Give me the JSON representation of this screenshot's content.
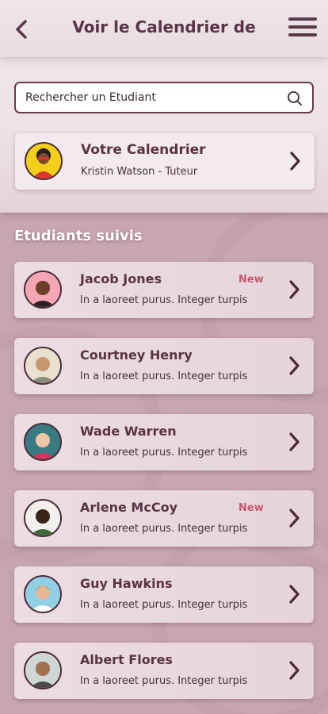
{
  "header": {
    "title": "Voir le Calendrier de",
    "back_icon": "chevron-left-icon",
    "menu_icon": "hamburger-menu-icon"
  },
  "search": {
    "placeholder": "Rechercher un Etudiant",
    "icon": "search-icon"
  },
  "my_calendar": {
    "title": "Votre Calendrier",
    "subtitle": "Kristin Watson - Tuteur"
  },
  "students_section": {
    "title": "Etudiants suivis"
  },
  "students": [
    {
      "name": "Jacob Jones",
      "message": "In a laoreet purus. Integer turpis",
      "badge": "New"
    },
    {
      "name": "Courtney Henry",
      "message": "In a laoreet purus. Integer turpis",
      "badge": ""
    },
    {
      "name": "Wade Warren",
      "message": "In a laoreet purus. Integer turpis",
      "badge": ""
    },
    {
      "name": "Arlene McCoy",
      "message": "In a laoreet purus. Integer turpis",
      "badge": "New"
    },
    {
      "name": "Guy Hawkins",
      "message": "In a laoreet purus. Integer turpis",
      "badge": ""
    },
    {
      "name": "Albert Flores",
      "message": "In a laoreet purus. Integer turpis",
      "badge": ""
    }
  ],
  "colors": {
    "primary": "#5a3444",
    "badge_new": "#c45a6e",
    "background": "#c7a6b2"
  }
}
